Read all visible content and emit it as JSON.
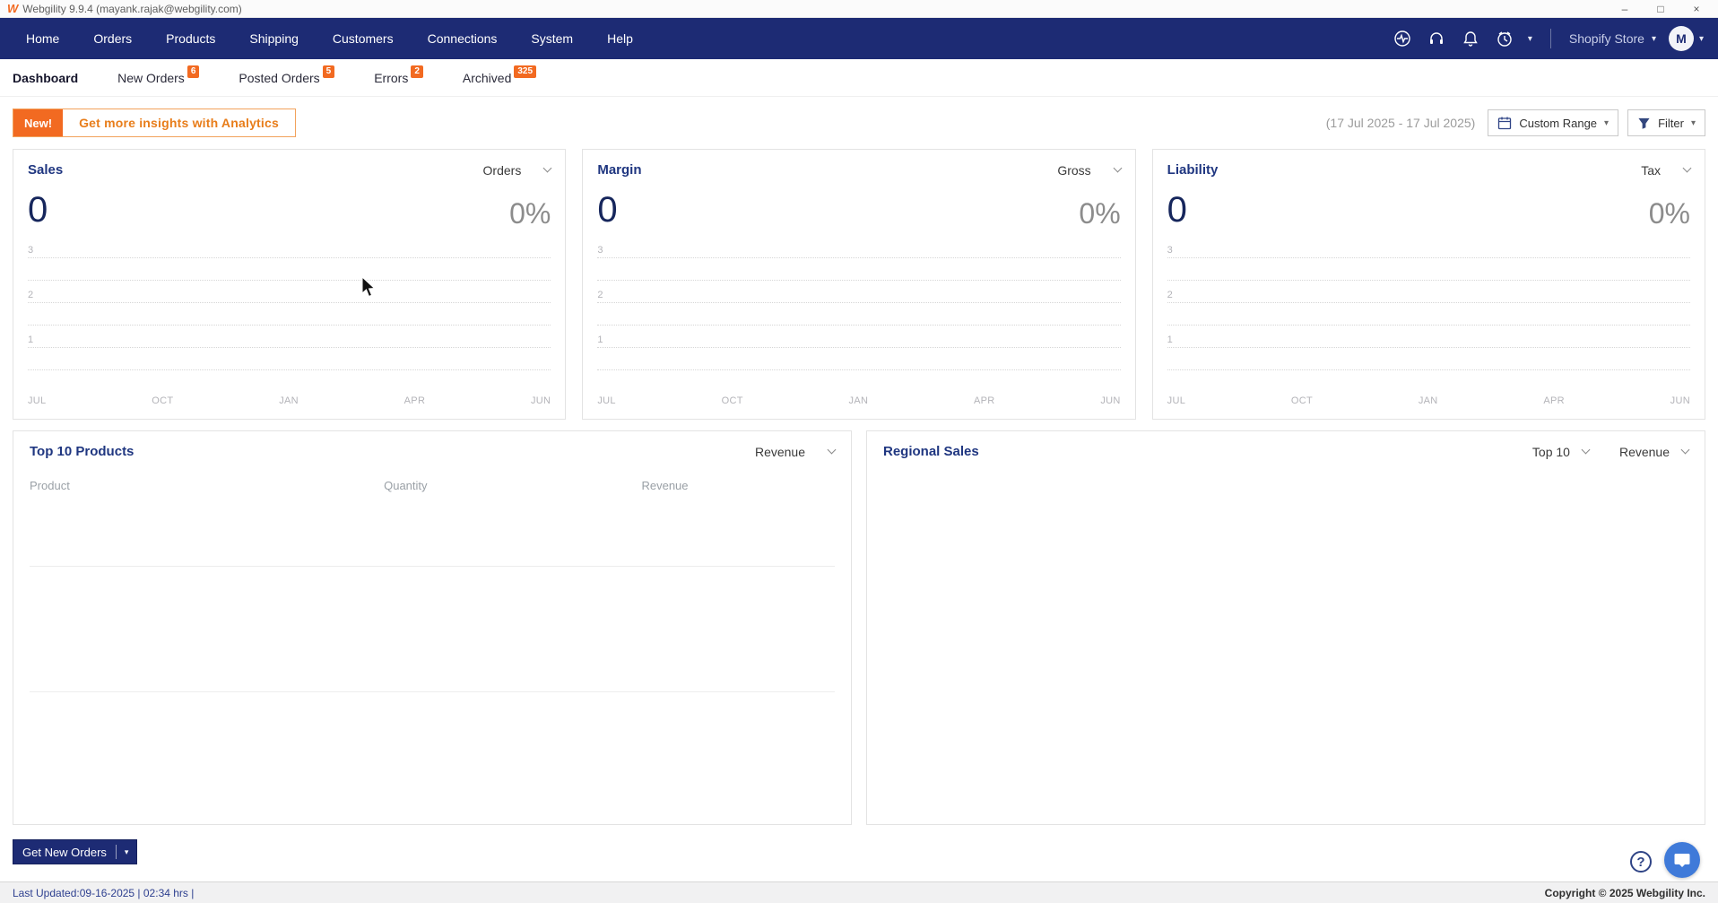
{
  "window": {
    "title": "Webgility 9.9.4 (mayank.rajak@webgility.com)"
  },
  "icons": {
    "minimize": "–",
    "maximize": "□",
    "close": "×",
    "caret_down": "▾",
    "help": "?",
    "logo": "W"
  },
  "nav": {
    "items": [
      {
        "label": "Home"
      },
      {
        "label": "Orders"
      },
      {
        "label": "Products"
      },
      {
        "label": "Shipping"
      },
      {
        "label": "Customers"
      },
      {
        "label": "Connections"
      },
      {
        "label": "System"
      },
      {
        "label": "Help"
      }
    ],
    "store_selector": "Shopify Store",
    "avatar_initial": "M"
  },
  "tabs": {
    "items": [
      {
        "label": "Dashboard"
      },
      {
        "label": "New Orders",
        "badge": "6"
      },
      {
        "label": "Posted Orders",
        "badge": "5"
      },
      {
        "label": "Errors",
        "badge": "2"
      },
      {
        "label": "Archived",
        "badge": "325"
      }
    ]
  },
  "banner": {
    "badge": "New!",
    "message": "Get more insights with Analytics"
  },
  "toolbar": {
    "date_range": "(17 Jul 2025 - 17 Jul 2025)",
    "custom_range_label": "Custom Range",
    "filter_label": "Filter"
  },
  "charts": {
    "cards": [
      {
        "title": "Sales",
        "dropdown": "Orders",
        "value": "0",
        "percent": "0%"
      },
      {
        "title": "Margin",
        "dropdown": "Gross",
        "value": "0",
        "percent": "0%"
      },
      {
        "title": "Liability",
        "dropdown": "Tax",
        "value": "0",
        "percent": "0%"
      }
    ],
    "y_ticks": [
      "3",
      "2",
      "1"
    ],
    "x_ticks": [
      "JUL",
      "OCT",
      "JAN",
      "APR",
      "JUN"
    ]
  },
  "chart_data": [
    {
      "type": "line",
      "title": "Sales",
      "metric": "Orders",
      "value": 0,
      "percent": "0%",
      "x": [
        "JUL",
        "OCT",
        "JAN",
        "APR",
        "JUN"
      ],
      "ylim": [
        0,
        3
      ],
      "series": []
    },
    {
      "type": "line",
      "title": "Margin",
      "metric": "Gross",
      "value": 0,
      "percent": "0%",
      "x": [
        "JUL",
        "OCT",
        "JAN",
        "APR",
        "JUN"
      ],
      "ylim": [
        0,
        3
      ],
      "series": []
    },
    {
      "type": "line",
      "title": "Liability",
      "metric": "Tax",
      "value": 0,
      "percent": "0%",
      "x": [
        "JUL",
        "OCT",
        "JAN",
        "APR",
        "JUN"
      ],
      "ylim": [
        0,
        3
      ],
      "series": []
    }
  ],
  "top_products": {
    "title": "Top 10 Products",
    "dropdown": "Revenue",
    "columns": [
      "Product",
      "Quantity",
      "Revenue"
    ],
    "rows": []
  },
  "regional_sales": {
    "title": "Regional Sales",
    "dropdown_top": "Top 10",
    "dropdown_metric": "Revenue"
  },
  "footer": {
    "get_new_orders_label": "Get New Orders",
    "last_updated": "Last Updated:09-16-2025 | 02:34 hrs |",
    "copyright": "Copyright © 2025 Webgility Inc."
  }
}
